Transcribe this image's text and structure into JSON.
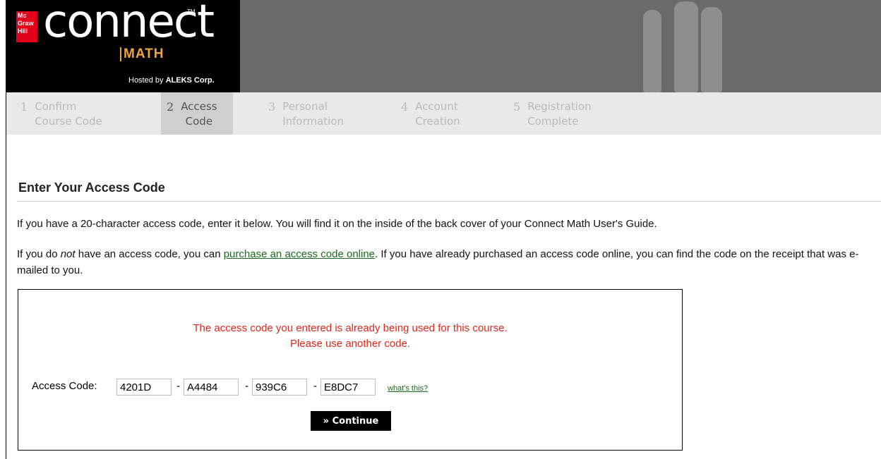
{
  "brand": {
    "mh_logo": "Mc Graw Hill",
    "product": "connect",
    "trademark": "TM",
    "subject": "MATH",
    "hosted_prefix": "Hosted by",
    "hosted_by": "ALEKS Corp."
  },
  "steps": [
    {
      "num": "1",
      "line1": "Confirm",
      "line2": "Course Code",
      "active": false
    },
    {
      "num": "2",
      "line1": "Access",
      "line2": "Code",
      "active": true
    },
    {
      "num": "3",
      "line1": "Personal",
      "line2": "Information",
      "active": false
    },
    {
      "num": "4",
      "line1": "Account",
      "line2": "Creation",
      "active": false
    },
    {
      "num": "5",
      "line1": "Registration",
      "line2": "Complete",
      "active": false
    }
  ],
  "content": {
    "title": "Enter Your Access Code",
    "p1": "If you have a  20-character access code, enter it below. You will find it on the inside of the back cover of your Connect Math User's Guide.",
    "p2_a": "If you do ",
    "p2_not": "not",
    "p2_b": " have an access code, you can ",
    "p2_link": "purchase an access code online",
    "p2_c": ". If you have already purchased an access code online, you can find the code on the receipt that was e-mailed to you."
  },
  "form": {
    "error_line1": "The access code you entered is already being used for this course.",
    "error_line2": "Please use another code.",
    "label": "Access Code:",
    "segments": [
      "4201D",
      "A4484",
      "939C6",
      "E8DC7"
    ],
    "separator": "-",
    "whats_this": "what's this?",
    "continue_label": "» Continue"
  },
  "colors": {
    "error": "#e3261b",
    "link": "#1c6a1c",
    "math_accent": "#f2a43a",
    "mh_red": "#e2001a"
  }
}
